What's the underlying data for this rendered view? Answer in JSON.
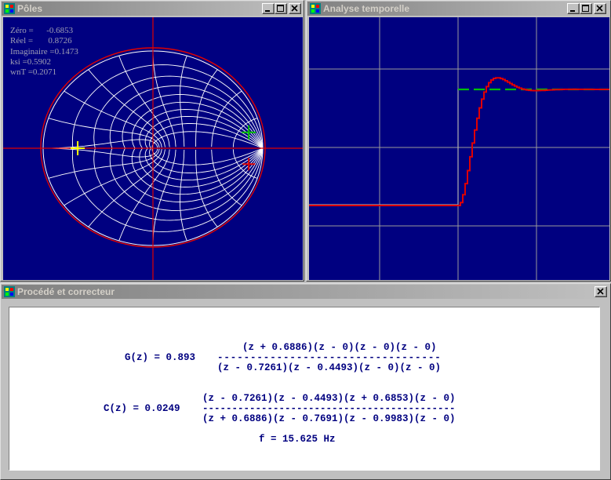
{
  "poles_window": {
    "title": "Pôles",
    "readout": {
      "zero": "Zéro =      -0.6853",
      "real": "Réel =       0.8726",
      "imag": "Imaginaire =0.1473",
      "ksi": "ksi =0.5902",
      "wnt": "wnT =0.2071"
    }
  },
  "time_window": {
    "title": "Analyse temporelle"
  },
  "process_window": {
    "title": "Procédé et correcteur",
    "g_prefix": "G(z) = 0.893",
    "g_num": "(z + 0.6886)(z - 0)(z - 0)(z - 0)",
    "g_bar": "----------------------------------",
    "g_den": "(z - 0.7261)(z - 0.4493)(z - 0)(z - 0)",
    "c_prefix": "C(z) = 0.0249",
    "c_num": "(z - 0.7261)(z - 0.4493)(z + 0.6853)(z - 0)",
    "c_bar": "-------------------------------------------",
    "c_den": "(z + 0.6886)(z - 0.7691)(z - 0.9983)(z - 0)",
    "freq": "f = 15.625 Hz"
  },
  "colors": {
    "plot_bg": "#000080",
    "grid": "#ffffff",
    "axis": "#e00000",
    "response": "#e00000",
    "setpoint": "#00c000",
    "title_text": "#d4d0c8"
  },
  "icons": [
    "app-icon",
    "minimize-icon",
    "maximize-icon",
    "close-icon"
  ]
}
